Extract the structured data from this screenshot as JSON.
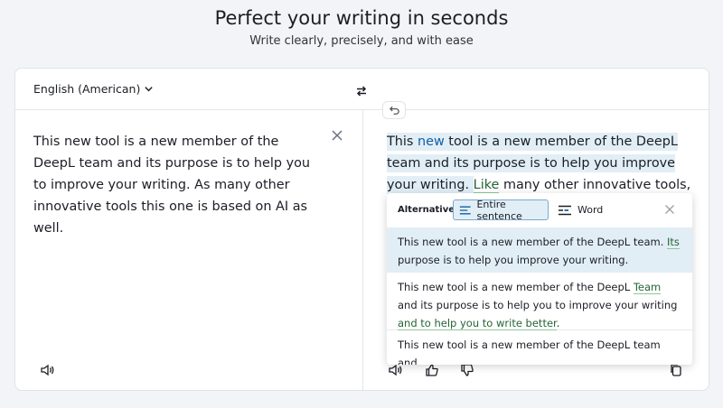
{
  "hero": {
    "title": "Perfect your writing in seconds",
    "subtitle": "Write clearly, precisely, and with ease"
  },
  "header": {
    "language": "English (American)"
  },
  "source": {
    "text": "This new tool is a new member of the DeepL team and its purpose is to help you to improve your writing. As many other innovative tools this one is based on AI as well."
  },
  "target": {
    "p1": "This ",
    "p2": "new",
    "p3": " tool is a new member of the DeepL team and its purpose is to help you improve your writing. ",
    "p4": "Like",
    "p5": " many other innovative tools,"
  },
  "alternatives": {
    "label": "Alternatives",
    "mode_sentence": "Entire sentence",
    "mode_word": "Word",
    "items": [
      {
        "a": "This new tool is a new member of the DeepL team. ",
        "b": "Its",
        "c": " purpose is to help you improve your writing."
      },
      {
        "a": "This new tool is a new member of the DeepL ",
        "b": "Team",
        "c": " and its purpose is to help you to improve your writing ",
        "d": "and to help you to write better",
        "e": "."
      },
      {
        "a": "This new tool is a new member of the DeepL team and"
      }
    ]
  },
  "colors": {
    "accent_blue": "#0f5fa4",
    "change_green": "#266335",
    "highlight": "#e2eef6"
  },
  "icons": [
    "chevron-down-icon",
    "swap-icon",
    "undo-icon",
    "close-icon",
    "speaker-icon",
    "thumbs-up-icon",
    "thumbs-down-icon",
    "copy-icon",
    "sentence-icon",
    "word-icon"
  ]
}
